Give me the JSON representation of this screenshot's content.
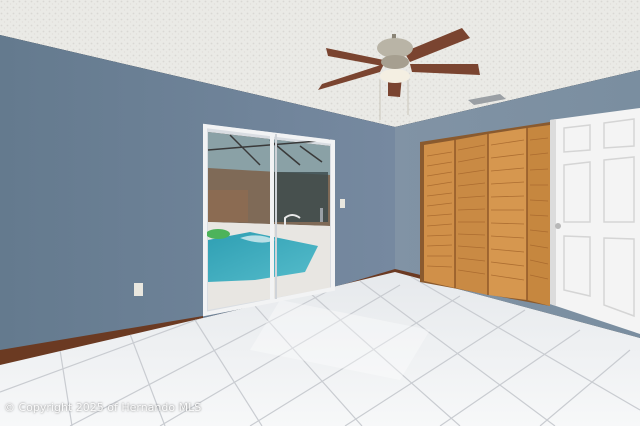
{
  "watermark": "© Copyright 2025 of Hernando MLS",
  "colors": {
    "ceiling": "#e9e8e4",
    "wall_left": "#6f8396",
    "wall_back": "#7e91a2",
    "baseboard": "#6b3a22",
    "floor_tile": "#eef0f2",
    "grout": "#c7cacf",
    "closet_wood": "#cf8f4a",
    "door": "#f4f4f4",
    "pool": "#3fa9b8",
    "fan_blade": "#7a4430"
  }
}
